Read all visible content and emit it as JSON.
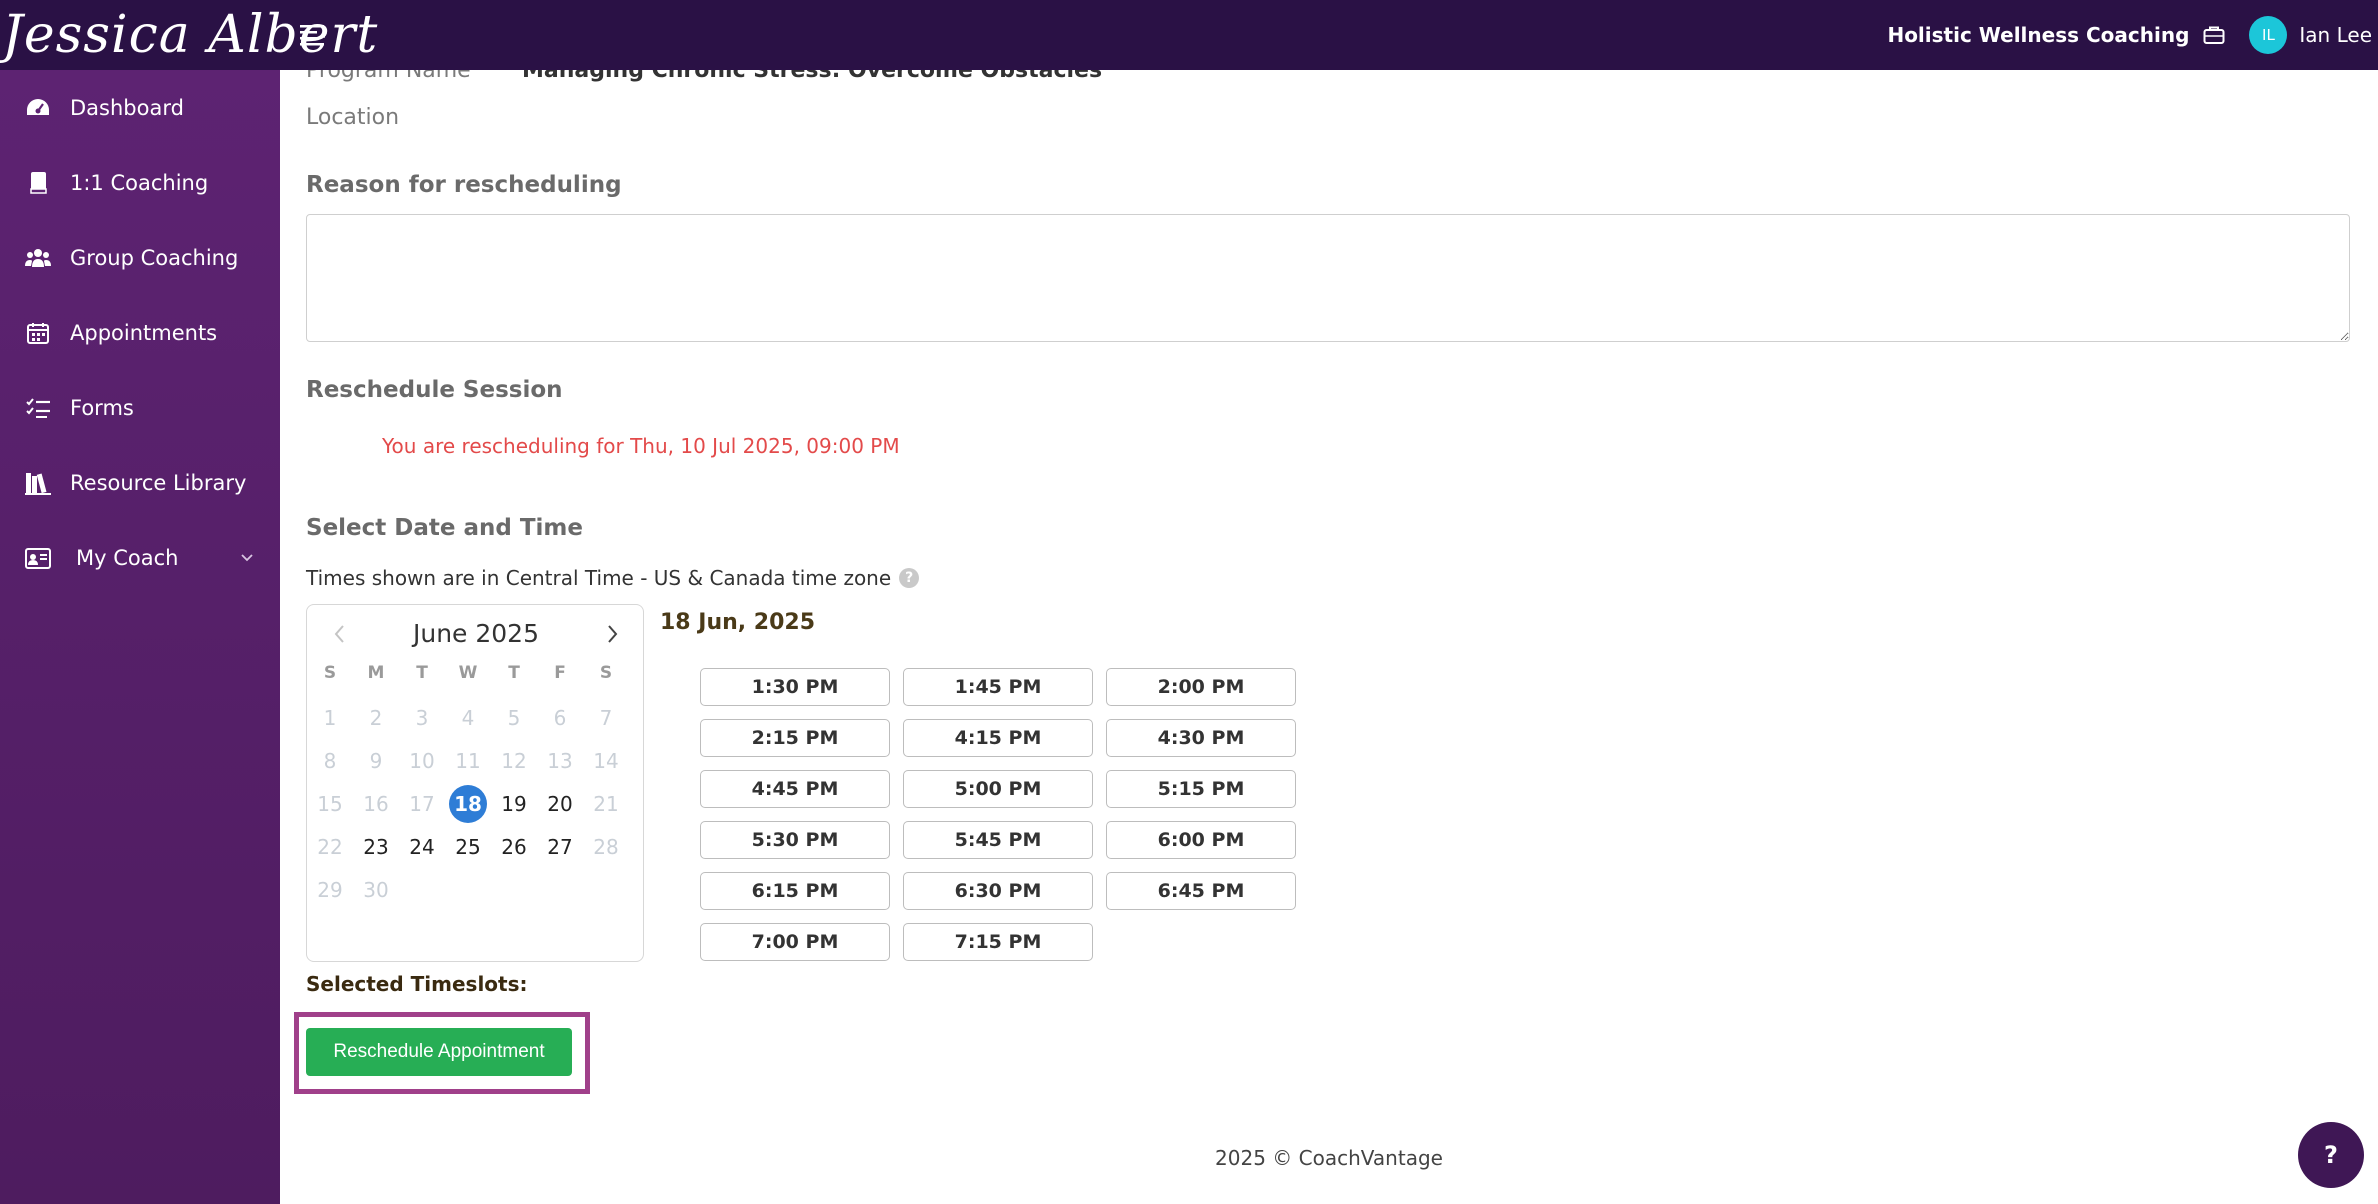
{
  "brand": {
    "logo_text": "Jessica Albert"
  },
  "header": {
    "company": "Holistic Wellness Coaching",
    "avatar_initials": "IL",
    "user_name": "Ian Lee"
  },
  "sidebar": {
    "items": [
      {
        "label": "Dashboard",
        "icon": "dashboard-gauge-icon"
      },
      {
        "label": "1:1 Coaching",
        "icon": "book-icon"
      },
      {
        "label": "Group Coaching",
        "icon": "users-icon"
      },
      {
        "label": "Appointments",
        "icon": "calendar-icon"
      },
      {
        "label": "Forms",
        "icon": "checklist-icon"
      },
      {
        "label": "Resource Library",
        "icon": "library-icon"
      },
      {
        "label": "My Coach",
        "icon": "coach-card-icon"
      }
    ]
  },
  "form": {
    "program_label": "Program Name",
    "program_value": "Managing Chronic Stress: Overcome Obstacles",
    "location_label": "Location",
    "reason_label": "Reason for rescheduling",
    "reason_value": "",
    "reschedule_title": "Reschedule Session",
    "reschedule_notice": "You are rescheduling for Thu, 10 Jul 2025, 09:00 PM",
    "select_title": "Select Date and Time",
    "timezone_note": "Times shown are in Central Time - US & Canada time zone",
    "help_glyph": "?"
  },
  "calendar": {
    "month_title": "June 2025",
    "weekdays": [
      "S",
      "M",
      "T",
      "W",
      "T",
      "F",
      "S"
    ],
    "weeks": [
      [
        "1",
        "2",
        "3",
        "4",
        "5",
        "6",
        "7"
      ],
      [
        "8",
        "9",
        "10",
        "11",
        "12",
        "13",
        "14"
      ],
      [
        "15",
        "16",
        "17",
        "18",
        "19",
        "20",
        "21"
      ],
      [
        "22",
        "23",
        "24",
        "25",
        "26",
        "27",
        "28"
      ],
      [
        "29",
        "30"
      ]
    ],
    "selected_day": "18",
    "available_days": [
      "18",
      "19",
      "20",
      "23",
      "24",
      "25",
      "26",
      "27"
    ]
  },
  "slots": {
    "date_heading": "18 Jun, 2025",
    "times": [
      "1:30 PM",
      "1:45 PM",
      "2:00 PM",
      "2:15 PM",
      "4:15 PM",
      "4:30 PM",
      "4:45 PM",
      "5:00 PM",
      "5:15 PM",
      "5:30 PM",
      "5:45 PM",
      "6:00 PM",
      "6:15 PM",
      "6:30 PM",
      "6:45 PM",
      "7:00 PM",
      "7:15 PM"
    ]
  },
  "selected_timeslots_label": "Selected Timeslots:",
  "reschedule_button": "Reschedule Appointment",
  "footer": "2025 © CoachVantage",
  "help_fab": "?",
  "colors": {
    "topbar": "#2a1145",
    "sidebar": "#5d2372",
    "primary_button": "#27ae55",
    "notice_red": "#e34a4a",
    "selected_day": "#2e7dd6",
    "highlight_border": "#a0408a",
    "avatar": "#1cc6d9"
  }
}
